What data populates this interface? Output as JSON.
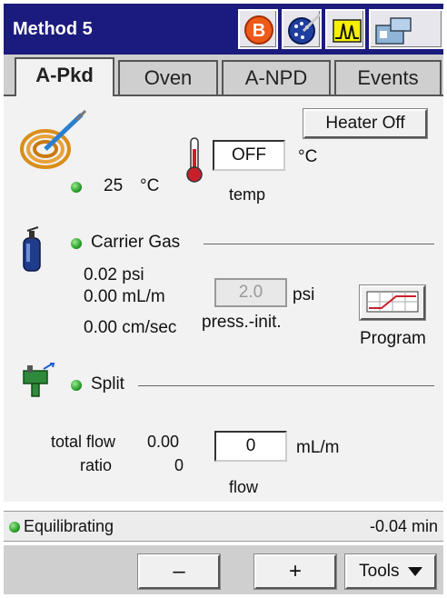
{
  "header": {
    "title": "Method 5",
    "icons": [
      "b-icon",
      "dial-icon",
      "chromatogram-icon",
      "instrument-icon"
    ]
  },
  "tabs": [
    {
      "label": "A-Pkd",
      "active": true
    },
    {
      "label": "Oven"
    },
    {
      "label": "A-NPD"
    },
    {
      "label": "Events"
    }
  ],
  "temperature": {
    "heater_button": "Heater Off",
    "actual_value": "25",
    "actual_unit": "°C",
    "setpoint": "OFF",
    "setpoint_unit": "°C",
    "setpoint_caption": "temp"
  },
  "carrier_gas": {
    "label": "Carrier Gas",
    "pressure": "0.02 psi",
    "flow": "0.00 mL/m",
    "velocity": "0.00 cm/sec",
    "press_init_value": "2.0",
    "press_unit": "psi",
    "press_caption": "press.-init.",
    "program_label": "Program"
  },
  "split": {
    "label": "Split",
    "total_flow_label": "total flow",
    "total_flow_value": "0.00",
    "ratio_label": "ratio",
    "ratio_value": "0",
    "flow_value": "0",
    "flow_unit": "mL/m",
    "flow_caption": "flow"
  },
  "status": {
    "text": "Equilibrating",
    "time": "-0.04 min"
  },
  "toolbar": {
    "minus_label": "–",
    "plus_label": "+",
    "tools_label": "Tools"
  },
  "colors": {
    "title_bar": "#1b1b7e",
    "status_led": "#27a02a"
  }
}
